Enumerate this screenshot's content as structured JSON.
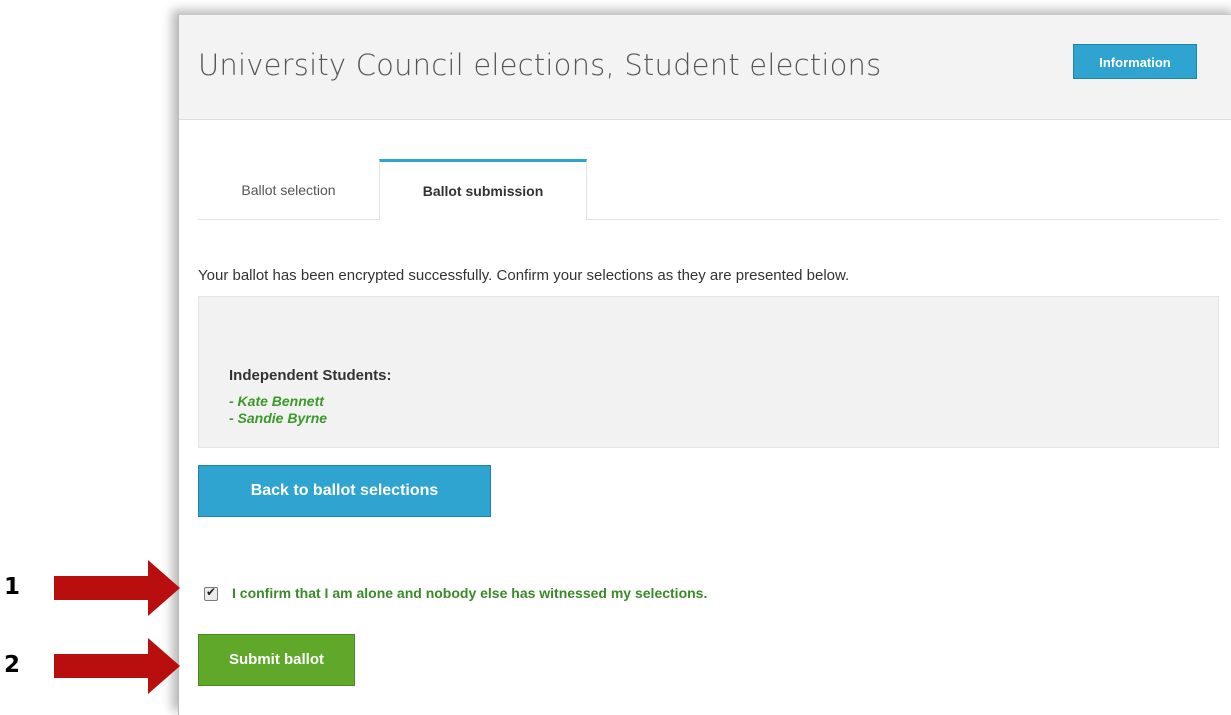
{
  "header": {
    "title": "University Council elections, Student elections",
    "info_button": "Information"
  },
  "tabs": [
    {
      "label": "Ballot selection",
      "active": false
    },
    {
      "label": "Ballot submission",
      "active": true
    }
  ],
  "message": "Your ballot has been encrypted successfully. Confirm your selections as they are presented below.",
  "summary": {
    "group": "Independent Students:",
    "candidates": [
      "- Kate Bennett",
      "- Sandie Byrne"
    ]
  },
  "back_button": "Back to ballot selections",
  "confirmation": {
    "checked": true,
    "label": "I confirm that I am alone and nobody else has witnessed my selections."
  },
  "submit_button": "Submit ballot",
  "annotations": [
    {
      "number": "1"
    },
    {
      "number": "2"
    }
  ],
  "colors": {
    "accent_blue": "#2fa4d0",
    "submit_green": "#5fa829",
    "candidate_green": "#3a9a2a",
    "arrow_red": "#b80e0e"
  }
}
